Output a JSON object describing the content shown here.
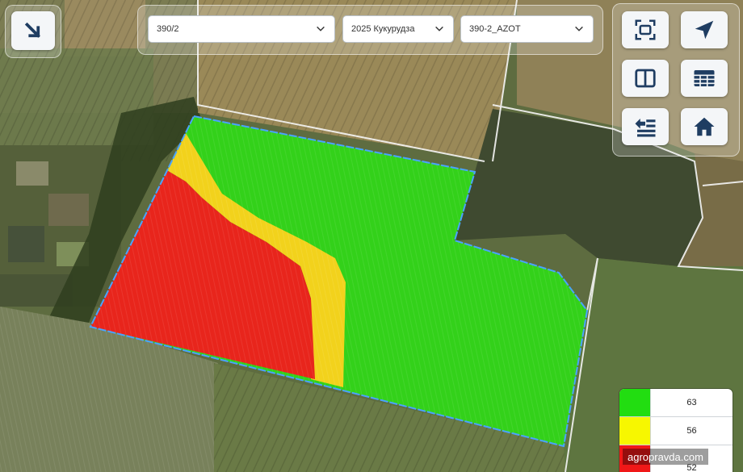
{
  "toolbar": {
    "selects": [
      {
        "value": "390/2"
      },
      {
        "value": "2025 Кукурудза"
      },
      {
        "value": "390-2_AZOT"
      }
    ]
  },
  "map_tools": {
    "collapse_icon": "arrow-down-right-icon",
    "buttons": [
      "fit-screen-icon",
      "locate-arrow-icon",
      "split-view-icon",
      "table-icon",
      "list-import-icon",
      "home-icon"
    ]
  },
  "legend": [
    {
      "color": "#22dd11",
      "value": "63"
    },
    {
      "color": "#f7f700",
      "value": "56"
    },
    {
      "color": "#f01818",
      "value": "52"
    }
  ],
  "watermark": "agropravda.com",
  "colors": {
    "zone_high": "#33d11a",
    "zone_mid": "#f2d21c",
    "zone_low": "#e8251c",
    "field_border": "#4aa3ff",
    "icon_blue": "#1f3d62"
  }
}
